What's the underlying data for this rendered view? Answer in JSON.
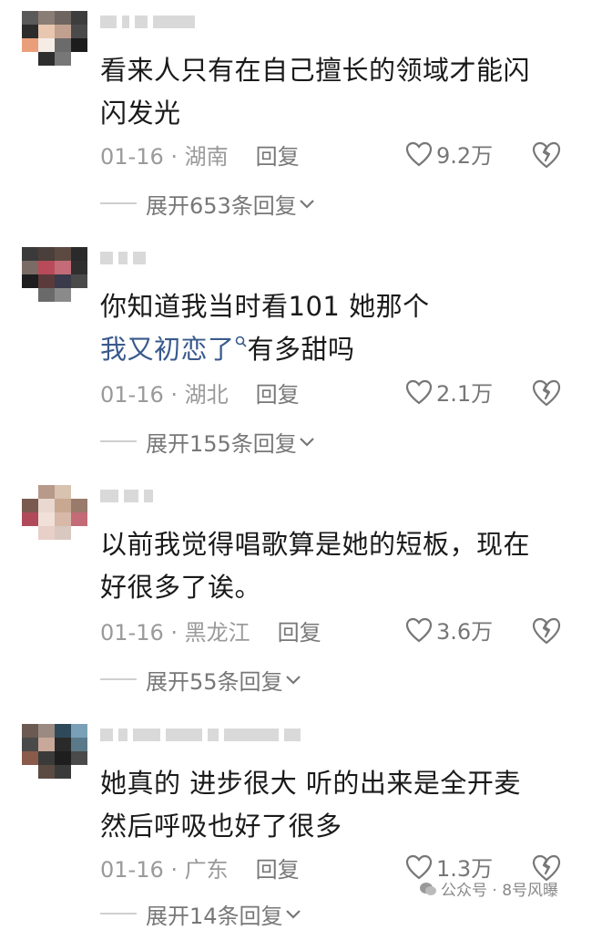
{
  "comments": [
    {
      "text_lines": [
        "看来人只有在自己擅长的领域才能闪",
        "闪发光"
      ],
      "date": "01-16 · 湖南",
      "reply_label": "回复",
      "likes": "9.2万",
      "expand": "展开653条回复"
    },
    {
      "text_lines": [
        "你知道我当时看101 她那个"
      ],
      "link_text": "我又初恋了",
      "after_link_text": "有多甜吗",
      "date": "01-16 · 湖北",
      "reply_label": "回复",
      "likes": "2.1万",
      "expand": "展开155条回复"
    },
    {
      "text_lines": [
        "以前我觉得唱歌算是她的短板，现在",
        "好很多了诶。"
      ],
      "date": "01-16 · 黑龙江",
      "reply_label": "回复",
      "likes": "3.6万",
      "expand": "展开55条回复"
    },
    {
      "text_lines": [
        "她真的 进步很大 听的出来是全开麦",
        "然后呼吸也好了很多"
      ],
      "date": "01-16 · 广东",
      "reply_label": "回复",
      "likes": "1.3万",
      "expand": "展开14条回复"
    }
  ],
  "watermark": "公众号 · 8号风曝",
  "icons": {
    "like": "heart-outline-icon",
    "dislike": "broken-heart-icon",
    "expand": "chevron-down-icon",
    "search_link": "search-icon",
    "watermark": "wechat-icon"
  },
  "colors": {
    "text": "#1a1a1a",
    "meta": "#9a9a9a",
    "link": "#3a5a8c"
  }
}
